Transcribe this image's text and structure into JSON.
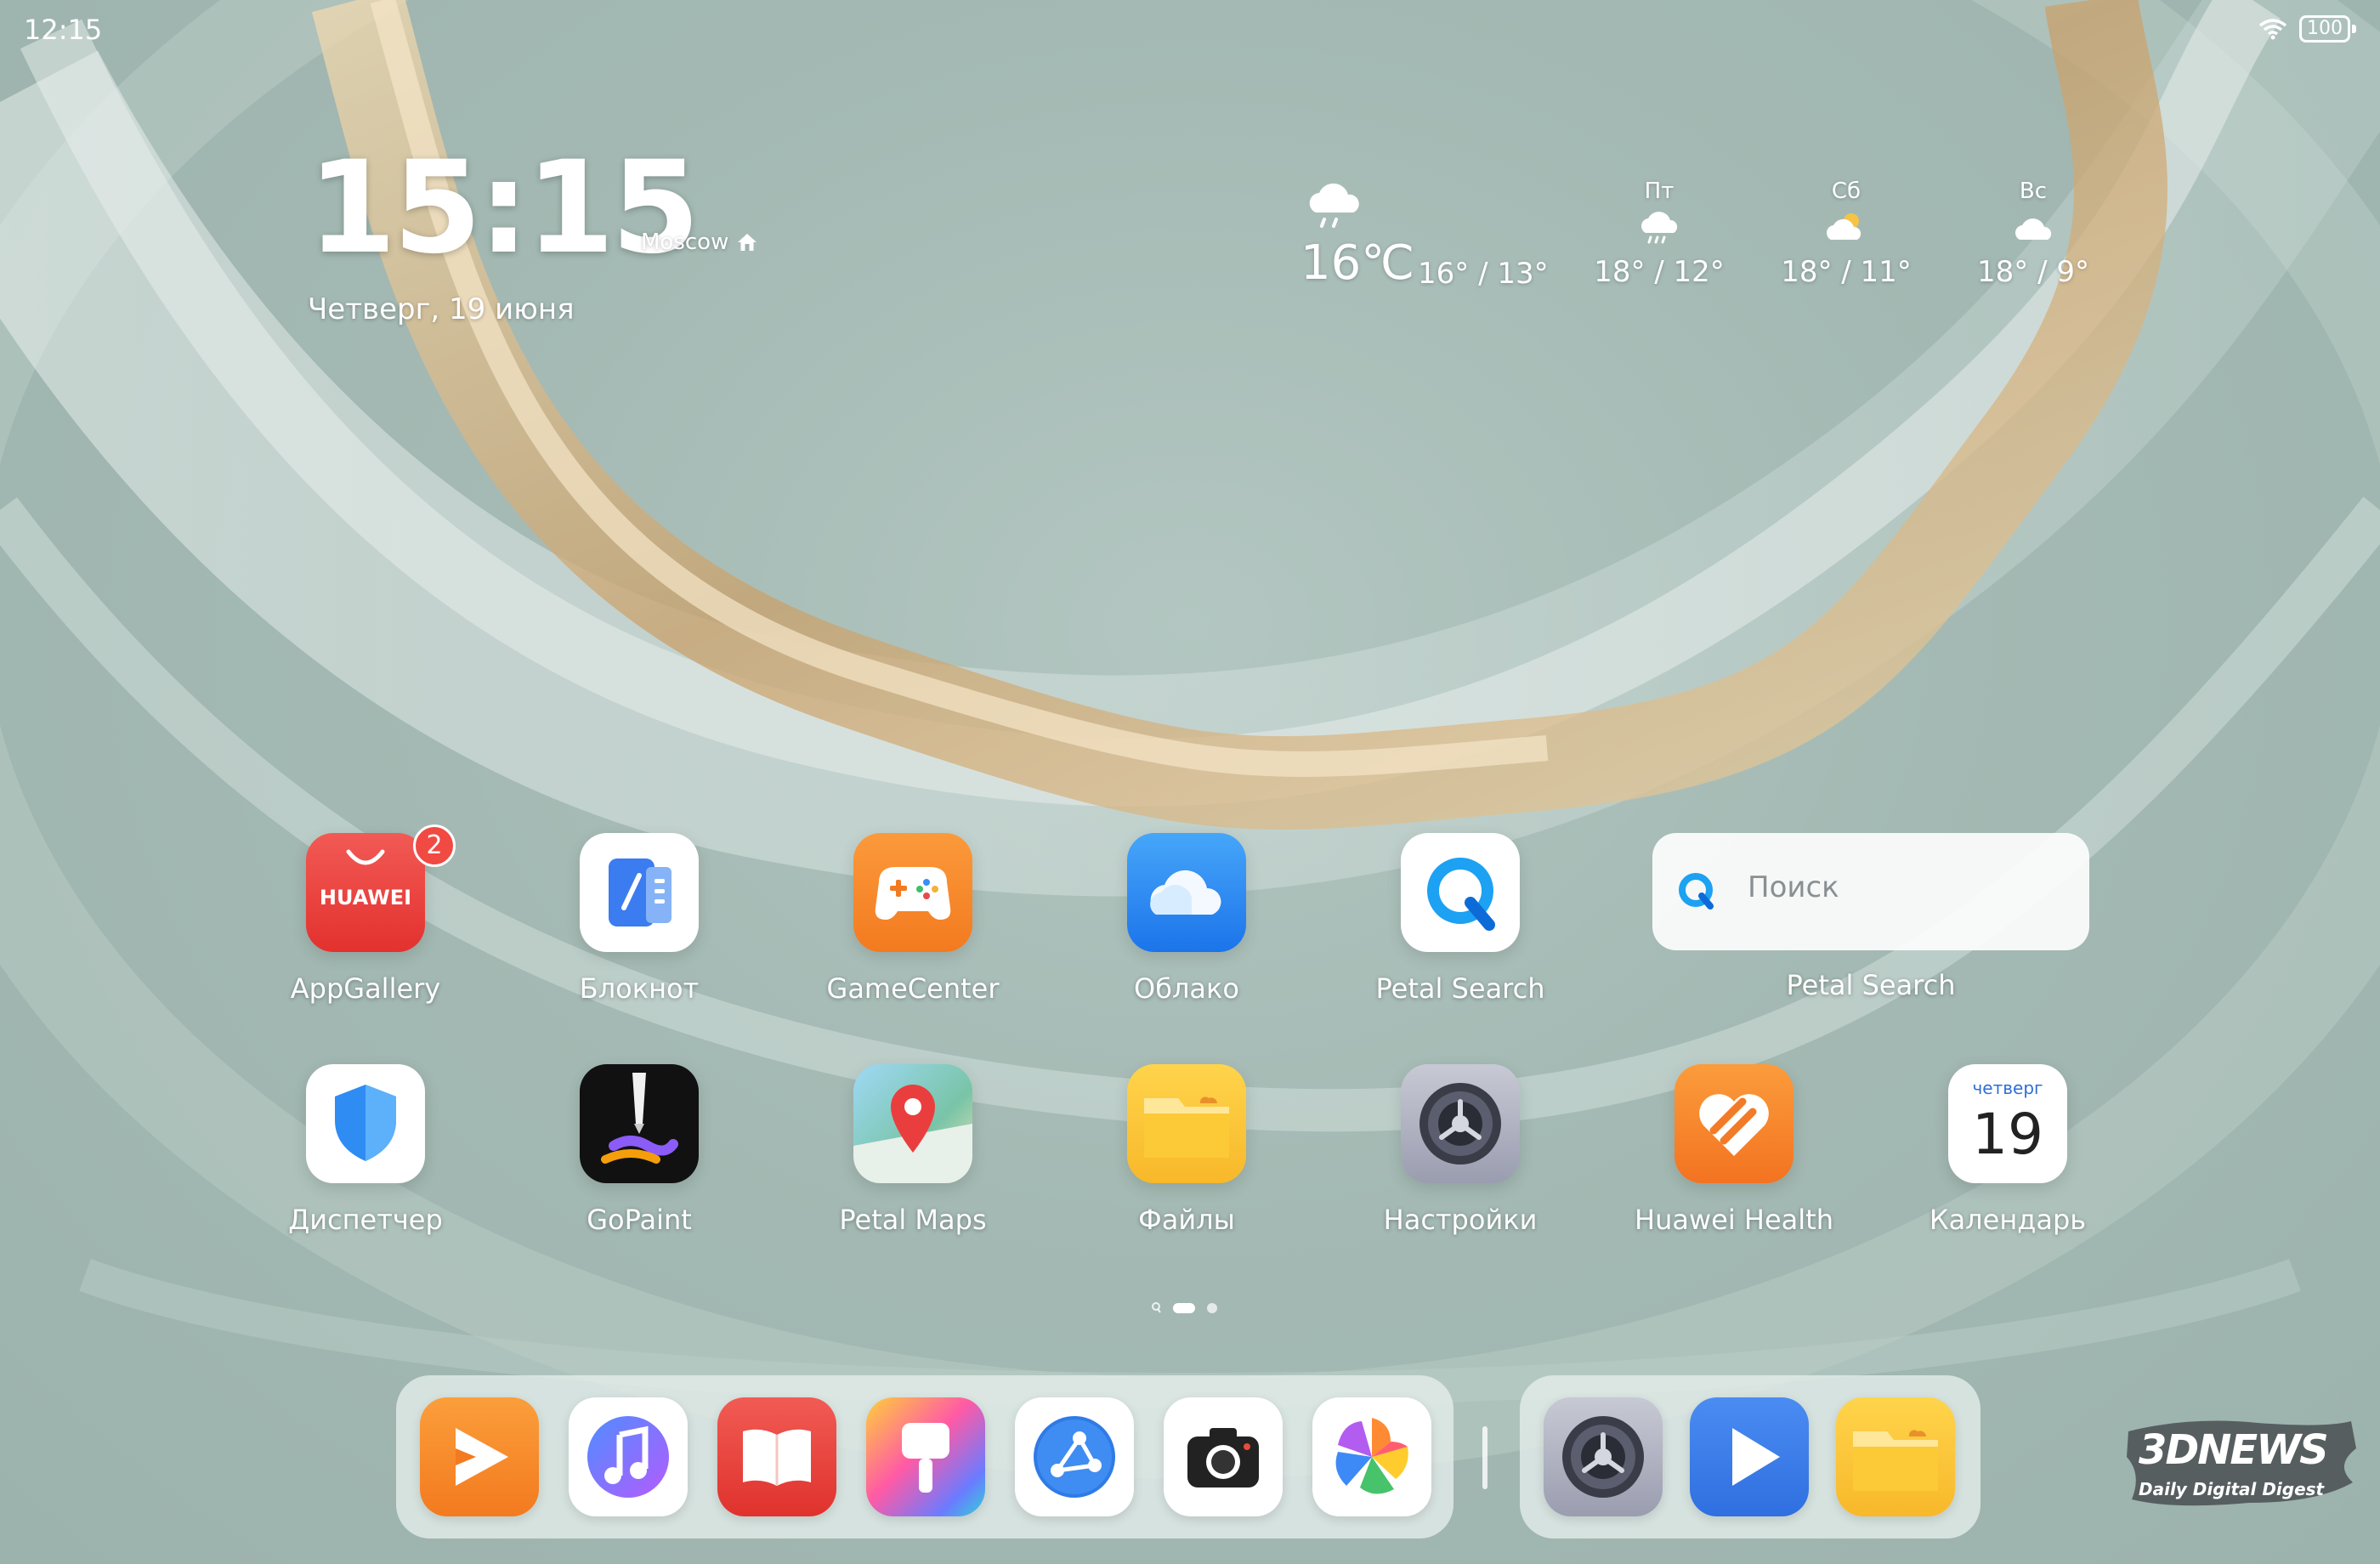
{
  "status_bar": {
    "time": "12:15",
    "battery": "100"
  },
  "clock_widget": {
    "time": "15:15",
    "city": "Moscow",
    "date": "Четверг, 19 июня"
  },
  "weather_widget": {
    "current_temp": "16℃",
    "current_range": "16° / 13°",
    "forecast": [
      {
        "day": "Пт",
        "range": "18° / 12°",
        "icon": "rain-cloud-icon"
      },
      {
        "day": "Сб",
        "range": "18° / 11°",
        "icon": "partly-cloudy-icon"
      },
      {
        "day": "Вс",
        "range": "18° / 9°",
        "icon": "cloudy-icon"
      }
    ]
  },
  "apps_row1": [
    {
      "label": "AppGallery",
      "badge": "2",
      "icon_text": "HUAWEI"
    },
    {
      "label": "Блокнот"
    },
    {
      "label": "GameCenter"
    },
    {
      "label": "Облако"
    },
    {
      "label": "Petal Search"
    }
  ],
  "search_widget": {
    "placeholder": "Поиск",
    "label": "Petal Search"
  },
  "apps_row2": [
    {
      "label": "Диспетчер"
    },
    {
      "label": "GoPaint"
    },
    {
      "label": "Petal Maps"
    },
    {
      "label": "Файлы"
    },
    {
      "label": "Настройки"
    },
    {
      "label": "Huawei Health"
    },
    {
      "label": "Календарь",
      "weekday": "четверг",
      "day": "19"
    }
  ],
  "pager": {
    "pages": 3,
    "active": 2
  },
  "dock": {
    "main": [
      "video-app-icon",
      "music-icon",
      "books-icon",
      "themes-icon",
      "browser-icon",
      "camera-icon",
      "gallery-icon"
    ],
    "recent": [
      "settings-icon",
      "video-player-icon",
      "files-icon"
    ]
  },
  "watermark": {
    "title": "3DNEWS",
    "subtitle": "Daily Digital Digest"
  }
}
